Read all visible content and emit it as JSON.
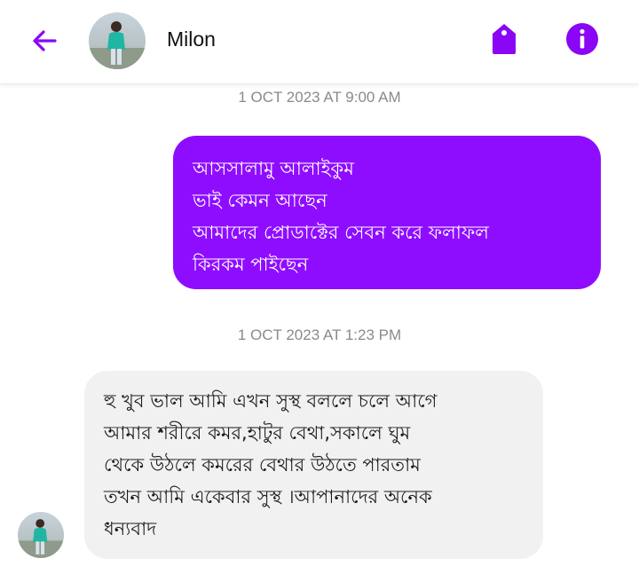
{
  "header": {
    "contact_name": "Milon",
    "accent_color": "#8a06f5",
    "back_icon": "arrow-left-icon",
    "tag_icon": "tag-icon",
    "info_icon": "info-icon"
  },
  "messages": [
    {
      "timestamp": "1 OCT 2023 AT 9:00 AM",
      "direction": "outgoing",
      "text": "আসসালামু আলাইকুম\nভাই কেমন আছেন\nআমাদের প্রোডাক্টের সেবন করে ফলাফল\nকিরকম পাইছেন",
      "bubble_color": "#8f0dff"
    },
    {
      "timestamp": "1 OCT 2023 AT 1:23 PM",
      "direction": "incoming",
      "text": "হু খুব ভাল আমি এখন সুস্থ বললে চলে আগে\nআমার শরীরে কমর,হাটুর বেথা,সকালে ঘুম\nথেকে উঠলে কমরের বেথার উঠতে পারতাম\nতখন আমি একেবার সুস্থ ।আপানাদের অনেক\nধন্যবাদ",
      "bubble_color": "#f1f1f1"
    }
  ]
}
